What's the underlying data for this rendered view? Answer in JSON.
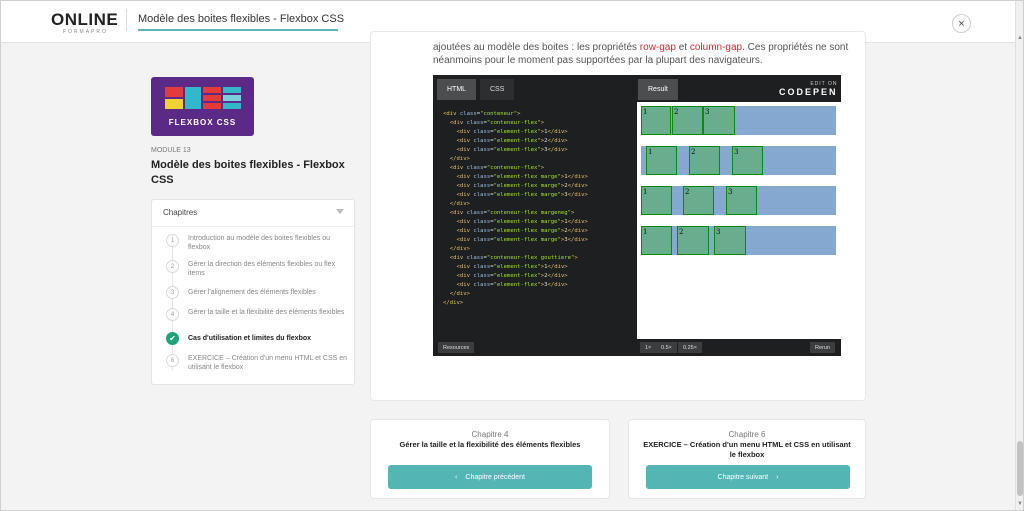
{
  "header": {
    "logo_main": "ONLINE",
    "logo_sub": "FORMAPRO",
    "title": "Modèle des boites flexibles - Flexbox CSS",
    "close_icon": "×"
  },
  "module": {
    "thumb_label": "FLEXBOX CSS",
    "number": "MODULE 13",
    "title": "Modèle des boites flexibles - Flexbox CSS"
  },
  "chapters": {
    "heading": "Chapitres",
    "items": [
      {
        "num": "1",
        "label": "Introduction au modèle des boites flexibles ou flexbox",
        "done": false
      },
      {
        "num": "2",
        "label": "Gérer la direction des éléments flexibles ou flex items",
        "done": false
      },
      {
        "num": "3",
        "label": "Gérer l'alignement des éléments flexibles",
        "done": false
      },
      {
        "num": "4",
        "label": "Gérer la taille et la flexibilité des éléments flexibles",
        "done": false
      },
      {
        "num": "✔",
        "label": "Cas d'utilisation et limites du flexbox",
        "done": true
      },
      {
        "num": "6",
        "label": "EXERCICE – Création d'un menu HTML et CSS en utilisant le flexbox",
        "done": false
      }
    ]
  },
  "content": {
    "text_before": "ajoutées au modèle des boites : les propriétés ",
    "prop1": "row-gap",
    "text_mid": " et ",
    "prop2": "column-gap",
    "text_after": ". Ces propriétés ne sont néanmoins pour le moment pas supportées par la plupart des navigateurs."
  },
  "codepen": {
    "tab_html": "HTML",
    "tab_css": "CSS",
    "tab_result": "Result",
    "edit_on": "EDIT ON",
    "brand": "CODEPEN",
    "resources": "Resources",
    "zoom": [
      "1×",
      "0.5×",
      "0.25×"
    ],
    "rerun": "Rerun",
    "box_labels": [
      "1",
      "2",
      "3"
    ]
  },
  "nav": {
    "prev": {
      "chapter": "Chapitre 4",
      "title": "Gérer la taille et la flexibilité des éléments flexibles",
      "button": "Chapitre précédent"
    },
    "next": {
      "chapter": "Chapitre 6",
      "title": "EXERCICE – Création d'un menu HTML et CSS en utilisant le flexbox",
      "button": "Chapitre suivant"
    }
  },
  "colors": {
    "accent": "#54b5b5",
    "done_green": "#1fa37b",
    "highlight_red": "#d8283a",
    "thumb_purple": "#5a2a86"
  }
}
